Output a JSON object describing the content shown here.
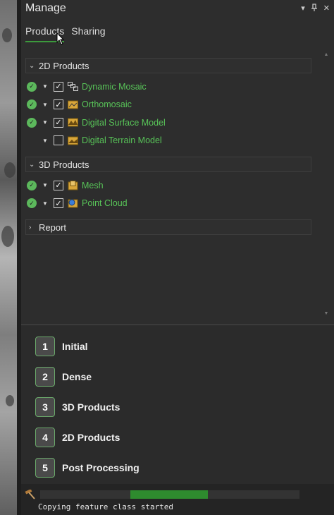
{
  "panel": {
    "title": "Manage",
    "tabs": [
      {
        "label": "Products",
        "active": true
      },
      {
        "label": "Sharing",
        "active": false
      }
    ]
  },
  "groups": {
    "g2d": {
      "label": "2D Products",
      "expanded": true
    },
    "g3d": {
      "label": "3D Products",
      "expanded": true
    },
    "report": {
      "label": "Report",
      "expanded": false
    }
  },
  "products_2d": [
    {
      "label": "Dynamic Mosaic",
      "status": "done",
      "checked": true,
      "icon": "mosaic-icon"
    },
    {
      "label": "Orthomosaic",
      "status": "done",
      "checked": true,
      "icon": "orthomosaic-icon"
    },
    {
      "label": "Digital Surface Model",
      "status": "done",
      "checked": true,
      "icon": "dsm-icon"
    },
    {
      "label": "Digital Terrain Model",
      "status": "none",
      "checked": false,
      "icon": "dtm-icon"
    }
  ],
  "products_3d": [
    {
      "label": "Mesh",
      "status": "done",
      "checked": true,
      "icon": "mesh-icon"
    },
    {
      "label": "Point Cloud",
      "status": "done",
      "checked": true,
      "icon": "point-cloud-icon"
    }
  ],
  "steps": [
    {
      "num": "1",
      "label": "Initial"
    },
    {
      "num": "2",
      "label": "Dense"
    },
    {
      "num": "3",
      "label": "3D Products"
    },
    {
      "num": "4",
      "label": "2D Products"
    },
    {
      "num": "5",
      "label": "Post Processing"
    }
  ],
  "status": {
    "message": "Copying feature class started",
    "icon": "hammer-icon"
  },
  "colors": {
    "accent": "#58c458",
    "ok": "#5cb85c",
    "progress": "#2e8b2e",
    "background": "#2d2d2d"
  }
}
